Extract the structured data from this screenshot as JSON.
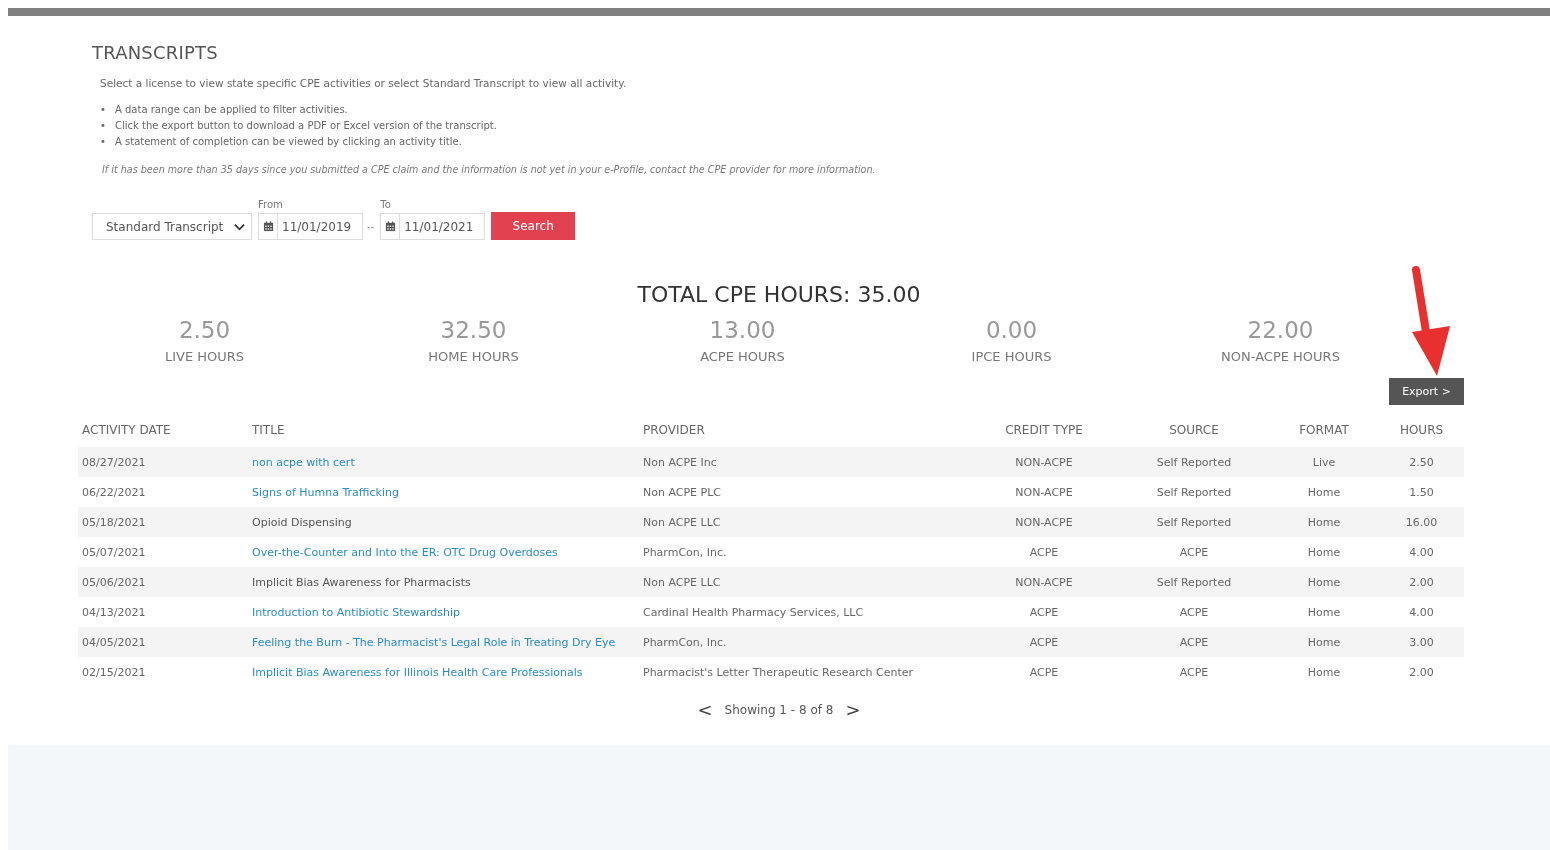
{
  "page": {
    "title": "TRANSCRIPTS",
    "intro": "Select a license to view state specific CPE activities or select Standard Transcript to view all activity.",
    "bullets": [
      {
        "marker": "•",
        "text": "A data range can be applied to filter activities."
      },
      {
        "marker": "•",
        "text": "Click the export button to download a PDF or Excel version of the transcript."
      },
      {
        "marker": "•",
        "text": "A statement of completion can be viewed by clicking an activity title."
      }
    ],
    "note": "If it has been more than 35 days since you submitted a CPE claim and the information is not yet in your e-Profile, contact the CPE provider for more information."
  },
  "filters": {
    "license_select": "Standard Transcript",
    "from_label": "From",
    "from_date": "11/01/2019",
    "separator": "--",
    "to_label": "To",
    "to_date": "11/01/2021",
    "search_button": "Search"
  },
  "summary": {
    "total": "TOTAL CPE HOURS: 35.00",
    "stats": [
      {
        "value": "2.50",
        "label": "LIVE HOURS"
      },
      {
        "value": "32.50",
        "label": "HOME HOURS"
      },
      {
        "value": "13.00",
        "label": "ACPE HOURS"
      },
      {
        "value": "0.00",
        "label": "IPCE HOURS"
      },
      {
        "value": "22.00",
        "label": "NON-ACPE HOURS"
      }
    ]
  },
  "export_button": "Export >",
  "table": {
    "columns": [
      "ACTIVITY DATE",
      "TITLE",
      "PROVIDER",
      "CREDIT TYPE",
      "SOURCE",
      "FORMAT",
      "HOURS"
    ],
    "rows": [
      {
        "date": "08/27/2021",
        "title": "non acpe with cert",
        "link": true,
        "provider": "Non ACPE Inc",
        "credit_type": "NON-ACPE",
        "source": "Self Reported",
        "format": "Live",
        "hours": "2.50"
      },
      {
        "date": "06/22/2021",
        "title": "Signs of Humna Trafficking",
        "link": true,
        "provider": "Non ACPE PLC",
        "credit_type": "NON-ACPE",
        "source": "Self Reported",
        "format": "Home",
        "hours": "1.50"
      },
      {
        "date": "05/18/2021",
        "title": "Opioid Dispensing",
        "link": false,
        "provider": "Non ACPE LLC",
        "credit_type": "NON-ACPE",
        "source": "Self Reported",
        "format": "Home",
        "hours": "16.00"
      },
      {
        "date": "05/07/2021",
        "title": "Over-the-Counter and Into the ER: OTC Drug Overdoses",
        "link": true,
        "provider": "PharmCon, Inc.",
        "credit_type": "ACPE",
        "source": "ACPE",
        "format": "Home",
        "hours": "4.00"
      },
      {
        "date": "05/06/2021",
        "title": "Implicit Bias Awareness for Pharmacists",
        "link": false,
        "provider": "Non ACPE LLC",
        "credit_type": "NON-ACPE",
        "source": "Self Reported",
        "format": "Home",
        "hours": "2.00"
      },
      {
        "date": "04/13/2021",
        "title": "Introduction to Antibiotic Stewardship",
        "link": true,
        "provider": "Cardinal Health Pharmacy Services, LLC",
        "credit_type": "ACPE",
        "source": "ACPE",
        "format": "Home",
        "hours": "4.00"
      },
      {
        "date": "04/05/2021",
        "title": "Feeling the Burn - The Pharmacist's Legal Role in Treating Dry Eye",
        "link": true,
        "provider": "PharmCon, Inc.",
        "credit_type": "ACPE",
        "source": "ACPE",
        "format": "Home",
        "hours": "3.00"
      },
      {
        "date": "02/15/2021",
        "title": "Implicit Bias Awareness for Illinois Health Care Professionals",
        "link": true,
        "provider": "Pharmacist's Letter Therapeutic Research Center",
        "credit_type": "ACPE",
        "source": "ACPE",
        "format": "Home",
        "hours": "2.00"
      }
    ]
  },
  "pagination": {
    "prev": "<",
    "text": "Showing 1 - 8 of 8",
    "next": ">"
  }
}
